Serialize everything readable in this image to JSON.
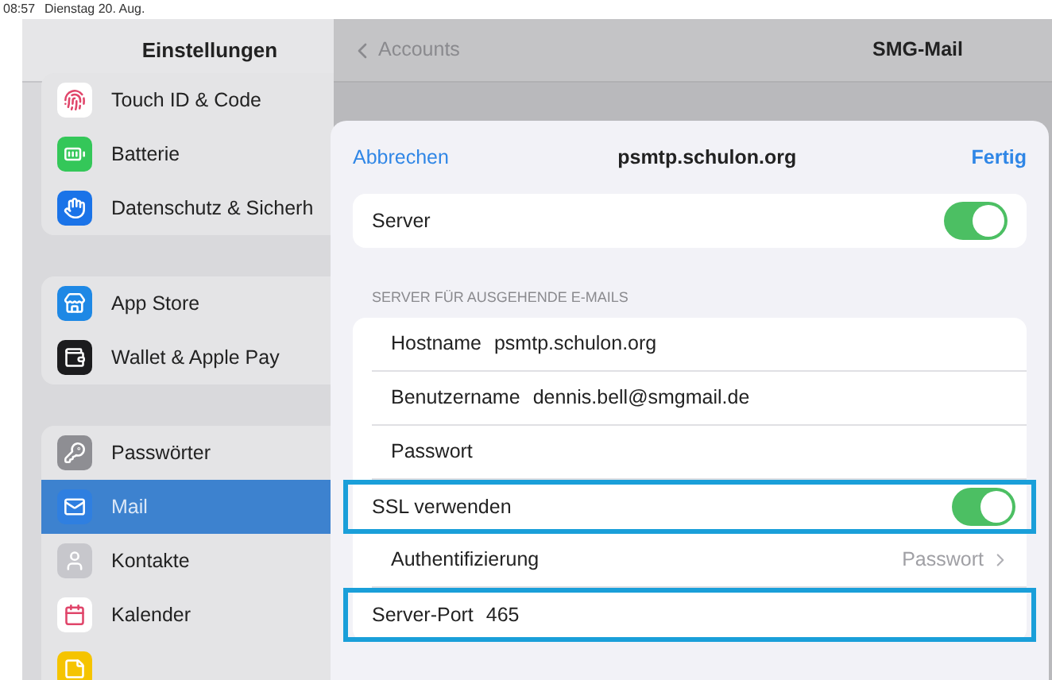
{
  "status_bar": {
    "time": "08:57",
    "date": "Dienstag 20. Aug."
  },
  "sidebar": {
    "title": "Einstellungen",
    "groups": [
      {
        "items": [
          {
            "label": "Touch ID & Code",
            "color": "#ffffff",
            "selected": false
          },
          {
            "label": "Batterie",
            "color": "#34c759",
            "selected": false
          },
          {
            "label": "Datenschutz & Sicherh",
            "color": "#1a73e8",
            "selected": false
          }
        ]
      },
      {
        "items": [
          {
            "label": "App Store",
            "color": "#1e88e5",
            "selected": false
          },
          {
            "label": "Wallet & Apple Pay",
            "color": "#1c1c1e",
            "selected": false
          }
        ]
      },
      {
        "items": [
          {
            "label": "Passwörter",
            "color": "#8e8e93",
            "selected": false
          },
          {
            "label": "Mail",
            "color": "#2f7fe0",
            "selected": true
          },
          {
            "label": "Kontakte",
            "color": "#c7c7cc",
            "selected": false
          },
          {
            "label": "Kalender",
            "color": "#ffffff",
            "selected": false
          },
          {
            "color": "#f5c400",
            "selected": false
          }
        ]
      }
    ]
  },
  "detail": {
    "back": "Accounts",
    "title": "SMG-Mail"
  },
  "sheet": {
    "cancel": "Abbrechen",
    "title": "psmtp.schulon.org",
    "done": "Fertig",
    "server": {
      "label": "Server",
      "on": true
    },
    "section_header": "SERVER FÜR AUSGEHENDE E-MAILS",
    "rows": [
      {
        "kind": "field",
        "label": "Hostname",
        "value": "psmtp.schulon.org",
        "highlighted": false
      },
      {
        "kind": "field",
        "label": "Benutzername",
        "value": "dennis.bell@smgmail.de",
        "highlighted": false
      },
      {
        "kind": "field",
        "label": "Passwort",
        "highlighted": false
      },
      {
        "kind": "toggle",
        "label": "SSL verwenden",
        "on": true,
        "highlighted": true
      },
      {
        "kind": "link",
        "label": "Authentifizierung",
        "value": "Passwort",
        "highlighted": false
      },
      {
        "kind": "field",
        "label": "Server-Port",
        "value": "465",
        "highlighted": true
      }
    ]
  }
}
